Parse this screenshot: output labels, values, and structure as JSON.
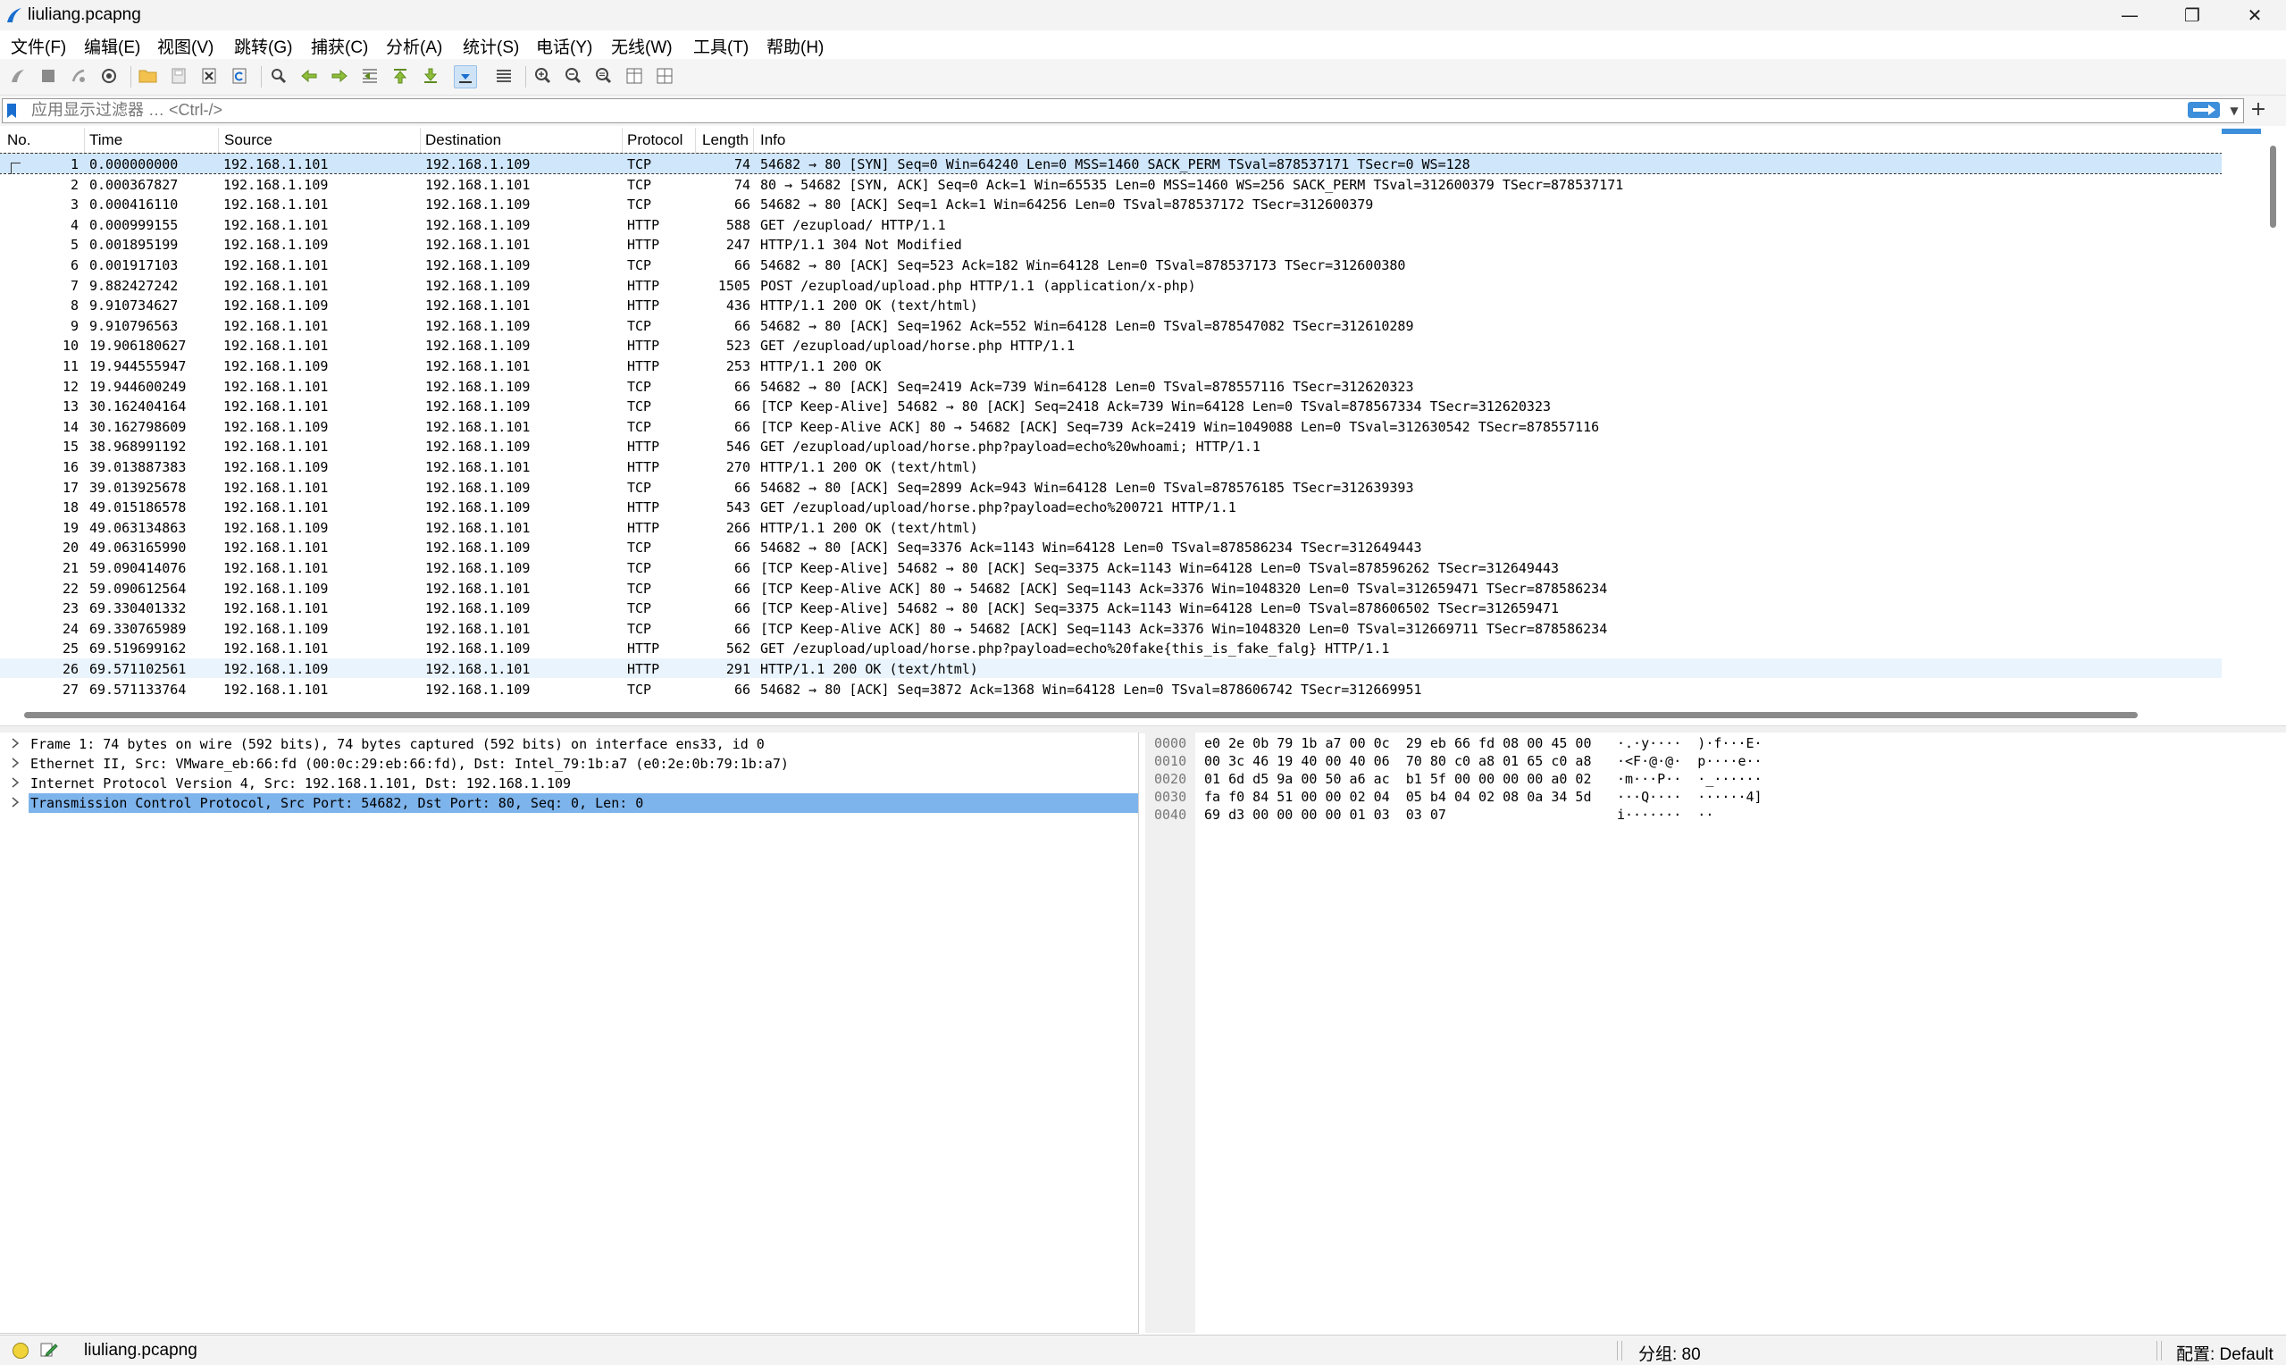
{
  "window": {
    "title": "liuliang.pcapng",
    "minimize_label": "—",
    "restore_label": "❐",
    "close_label": "✕"
  },
  "menu": [
    "文件(F)",
    "编辑(E)",
    "视图(V)",
    "跳转(G)",
    "捕获(C)",
    "分析(A)",
    "统计(S)",
    "电话(Y)",
    "无线(W)",
    "工具(T)",
    "帮助(H)"
  ],
  "toolbar_icons": [
    "start-capture-icon",
    "stop-capture-icon",
    "restart-capture-icon",
    "capture-options-icon",
    "open-file-icon",
    "save-file-icon",
    "close-file-icon",
    "reload-file-icon",
    "find-packet-icon",
    "go-back-icon",
    "go-forward-icon",
    "go-to-packet-icon",
    "go-first-icon",
    "go-last-icon",
    "auto-scroll-icon",
    "colorize-icon",
    "zoom-in-icon",
    "zoom-out-icon",
    "zoom-normal-icon",
    "resize-columns-icon",
    "expand-layout-icon"
  ],
  "filter": {
    "placeholder": "应用显示过滤器 … <Ctrl-/>",
    "value": ""
  },
  "packet_list": {
    "columns": [
      "No.",
      "Time",
      "Source",
      "Destination",
      "Protocol",
      "Length",
      "Info"
    ],
    "rows": [
      {
        "no": "1",
        "time": "0.000000000",
        "src": "192.168.1.101",
        "dst": "192.168.1.109",
        "proto": "TCP",
        "len": "74",
        "info": "54682 → 80 [SYN] Seq=0 Win=64240 Len=0 MSS=1460 SACK_PERM TSval=878537171 TSecr=0 WS=128"
      },
      {
        "no": "2",
        "time": "0.000367827",
        "src": "192.168.1.109",
        "dst": "192.168.1.101",
        "proto": "TCP",
        "len": "74",
        "info": "80 → 54682 [SYN, ACK] Seq=0 Ack=1 Win=65535 Len=0 MSS=1460 WS=256 SACK_PERM TSval=312600379 TSecr=878537171"
      },
      {
        "no": "3",
        "time": "0.000416110",
        "src": "192.168.1.101",
        "dst": "192.168.1.109",
        "proto": "TCP",
        "len": "66",
        "info": "54682 → 80 [ACK] Seq=1 Ack=1 Win=64256 Len=0 TSval=878537172 TSecr=312600379"
      },
      {
        "no": "4",
        "time": "0.000999155",
        "src": "192.168.1.101",
        "dst": "192.168.1.109",
        "proto": "HTTP",
        "len": "588",
        "info": "GET /ezupload/ HTTP/1.1"
      },
      {
        "no": "5",
        "time": "0.001895199",
        "src": "192.168.1.109",
        "dst": "192.168.1.101",
        "proto": "HTTP",
        "len": "247",
        "info": "HTTP/1.1 304 Not Modified"
      },
      {
        "no": "6",
        "time": "0.001917103",
        "src": "192.168.1.101",
        "dst": "192.168.1.109",
        "proto": "TCP",
        "len": "66",
        "info": "54682 → 80 [ACK] Seq=523 Ack=182 Win=64128 Len=0 TSval=878537173 TSecr=312600380"
      },
      {
        "no": "7",
        "time": "9.882427242",
        "src": "192.168.1.101",
        "dst": "192.168.1.109",
        "proto": "HTTP",
        "len": "1505",
        "info": "POST /ezupload/upload.php HTTP/1.1  (application/x-php)"
      },
      {
        "no": "8",
        "time": "9.910734627",
        "src": "192.168.1.109",
        "dst": "192.168.1.101",
        "proto": "HTTP",
        "len": "436",
        "info": "HTTP/1.1 200 OK  (text/html)"
      },
      {
        "no": "9",
        "time": "9.910796563",
        "src": "192.168.1.101",
        "dst": "192.168.1.109",
        "proto": "TCP",
        "len": "66",
        "info": "54682 → 80 [ACK] Seq=1962 Ack=552 Win=64128 Len=0 TSval=878547082 TSecr=312610289"
      },
      {
        "no": "10",
        "time": "19.906180627",
        "src": "192.168.1.101",
        "dst": "192.168.1.109",
        "proto": "HTTP",
        "len": "523",
        "info": "GET /ezupload/upload/horse.php HTTP/1.1"
      },
      {
        "no": "11",
        "time": "19.944555947",
        "src": "192.168.1.109",
        "dst": "192.168.1.101",
        "proto": "HTTP",
        "len": "253",
        "info": "HTTP/1.1 200 OK"
      },
      {
        "no": "12",
        "time": "19.944600249",
        "src": "192.168.1.101",
        "dst": "192.168.1.109",
        "proto": "TCP",
        "len": "66",
        "info": "54682 → 80 [ACK] Seq=2419 Ack=739 Win=64128 Len=0 TSval=878557116 TSecr=312620323"
      },
      {
        "no": "13",
        "time": "30.162404164",
        "src": "192.168.1.101",
        "dst": "192.168.1.109",
        "proto": "TCP",
        "len": "66",
        "info": "[TCP Keep-Alive] 54682 → 80 [ACK] Seq=2418 Ack=739 Win=64128 Len=0 TSval=878567334 TSecr=312620323"
      },
      {
        "no": "14",
        "time": "30.162798609",
        "src": "192.168.1.109",
        "dst": "192.168.1.101",
        "proto": "TCP",
        "len": "66",
        "info": "[TCP Keep-Alive ACK] 80 → 54682 [ACK] Seq=739 Ack=2419 Win=1049088 Len=0 TSval=312630542 TSecr=878557116"
      },
      {
        "no": "15",
        "time": "38.968991192",
        "src": "192.168.1.101",
        "dst": "192.168.1.109",
        "proto": "HTTP",
        "len": "546",
        "info": "GET /ezupload/upload/horse.php?payload=echo%20whoami; HTTP/1.1"
      },
      {
        "no": "16",
        "time": "39.013887383",
        "src": "192.168.1.109",
        "dst": "192.168.1.101",
        "proto": "HTTP",
        "len": "270",
        "info": "HTTP/1.1 200 OK  (text/html)"
      },
      {
        "no": "17",
        "time": "39.013925678",
        "src": "192.168.1.101",
        "dst": "192.168.1.109",
        "proto": "TCP",
        "len": "66",
        "info": "54682 → 80 [ACK] Seq=2899 Ack=943 Win=64128 Len=0 TSval=878576185 TSecr=312639393"
      },
      {
        "no": "18",
        "time": "49.015186578",
        "src": "192.168.1.101",
        "dst": "192.168.1.109",
        "proto": "HTTP",
        "len": "543",
        "info": "GET /ezupload/upload/horse.php?payload=echo%200721 HTTP/1.1"
      },
      {
        "no": "19",
        "time": "49.063134863",
        "src": "192.168.1.109",
        "dst": "192.168.1.101",
        "proto": "HTTP",
        "len": "266",
        "info": "HTTP/1.1 200 OK  (text/html)"
      },
      {
        "no": "20",
        "time": "49.063165990",
        "src": "192.168.1.101",
        "dst": "192.168.1.109",
        "proto": "TCP",
        "len": "66",
        "info": "54682 → 80 [ACK] Seq=3376 Ack=1143 Win=64128 Len=0 TSval=878586234 TSecr=312649443"
      },
      {
        "no": "21",
        "time": "59.090414076",
        "src": "192.168.1.101",
        "dst": "192.168.1.109",
        "proto": "TCP",
        "len": "66",
        "info": "[TCP Keep-Alive] 54682 → 80 [ACK] Seq=3375 Ack=1143 Win=64128 Len=0 TSval=878596262 TSecr=312649443"
      },
      {
        "no": "22",
        "time": "59.090612564",
        "src": "192.168.1.109",
        "dst": "192.168.1.101",
        "proto": "TCP",
        "len": "66",
        "info": "[TCP Keep-Alive ACK] 80 → 54682 [ACK] Seq=1143 Ack=3376 Win=1048320 Len=0 TSval=312659471 TSecr=878586234"
      },
      {
        "no": "23",
        "time": "69.330401332",
        "src": "192.168.1.101",
        "dst": "192.168.1.109",
        "proto": "TCP",
        "len": "66",
        "info": "[TCP Keep-Alive] 54682 → 80 [ACK] Seq=3375 Ack=1143 Win=64128 Len=0 TSval=878606502 TSecr=312659471"
      },
      {
        "no": "24",
        "time": "69.330765989",
        "src": "192.168.1.109",
        "dst": "192.168.1.101",
        "proto": "TCP",
        "len": "66",
        "info": "[TCP Keep-Alive ACK] 80 → 54682 [ACK] Seq=1143 Ack=3376 Win=1048320 Len=0 TSval=312669711 TSecr=878586234"
      },
      {
        "no": "25",
        "time": "69.519699162",
        "src": "192.168.1.101",
        "dst": "192.168.1.109",
        "proto": "HTTP",
        "len": "562",
        "info": "GET /ezupload/upload/horse.php?payload=echo%20fake{this_is_fake_falg} HTTP/1.1"
      },
      {
        "no": "26",
        "time": "69.571102561",
        "src": "192.168.1.109",
        "dst": "192.168.1.101",
        "proto": "HTTP",
        "len": "291",
        "info": "HTTP/1.1 200 OK  (text/html)"
      },
      {
        "no": "27",
        "time": "69.571133764",
        "src": "192.168.1.101",
        "dst": "192.168.1.109",
        "proto": "TCP",
        "len": "66",
        "info": "54682 → 80 [ACK] Seq=3872 Ack=1368 Win=64128 Len=0 TSval=878606742 TSecr=312669951"
      }
    ]
  },
  "details": [
    "Frame 1: 74 bytes on wire (592 bits), 74 bytes captured (592 bits) on interface ens33, id 0",
    "Ethernet II, Src: VMware_eb:66:fd (00:0c:29:eb:66:fd), Dst: Intel_79:1b:a7 (e0:2e:0b:79:1b:a7)",
    "Internet Protocol Version 4, Src: 192.168.1.101, Dst: 192.168.1.109",
    "Transmission Control Protocol, Src Port: 54682, Dst Port: 80, Seq: 0, Len: 0"
  ],
  "bytes": [
    {
      "offset": "0000",
      "hex": "e0 2e 0b 79 1b a7 00 0c  29 eb 66 fd 08 00 45 00",
      "ascii": "·.·y····  )·f···E·"
    },
    {
      "offset": "0010",
      "hex": "00 3c 46 19 40 00 40 06  70 80 c0 a8 01 65 c0 a8",
      "ascii": "·<F·@·@·  p····e··"
    },
    {
      "offset": "0020",
      "hex": "01 6d d5 9a 00 50 a6 ac  b1 5f 00 00 00 00 a0 02",
      "ascii": "·m···P··  ·_······"
    },
    {
      "offset": "0030",
      "hex": "fa f0 84 51 00 00 02 04  05 b4 04 02 08 0a 34 5d",
      "ascii": "···Q····  ······4]"
    },
    {
      "offset": "0040",
      "hex": "69 d3 00 00 00 00 01 03  03 07",
      "ascii": "i·······  ··"
    }
  ],
  "status": {
    "file": "liuliang.pcapng",
    "group": "分组: 80",
    "profile": "配置: Default"
  },
  "colors": {
    "selected_row": "#cfe6fb",
    "selected_detail": "#7eb4ec",
    "accent": "#3d8fdb"
  }
}
